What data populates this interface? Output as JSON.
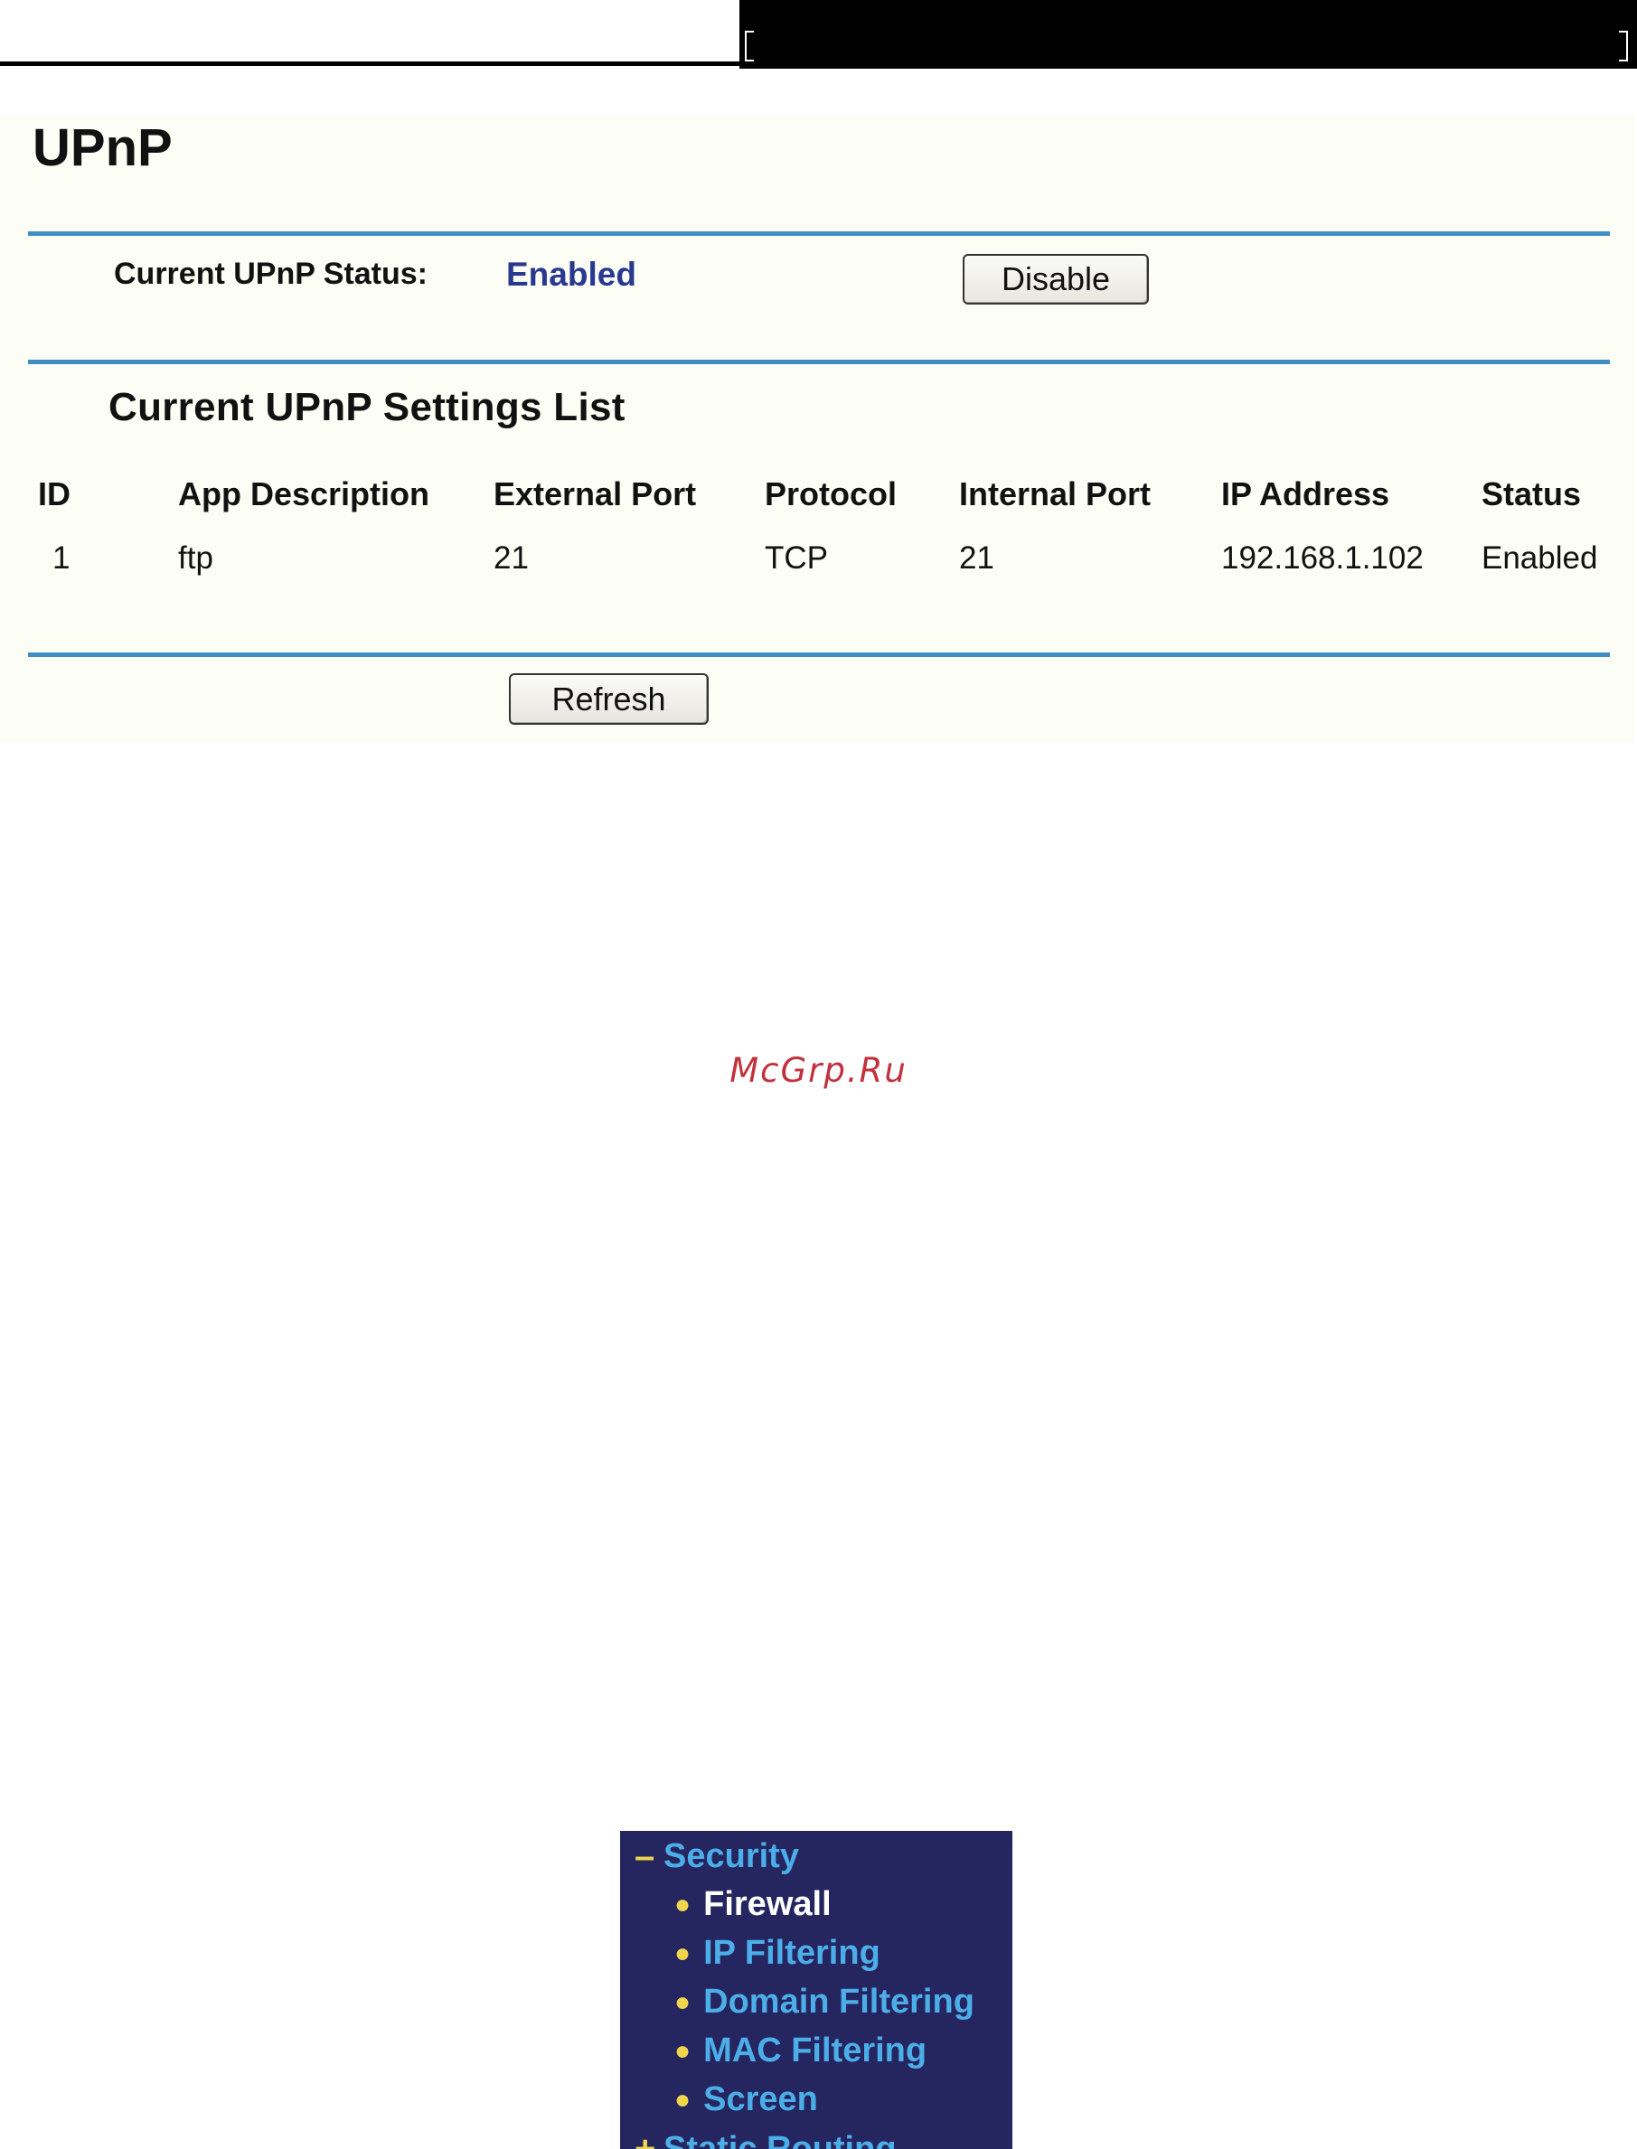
{
  "upnp": {
    "title": "UPnP",
    "status_label": "Current UPnP Status:",
    "status_value": "Enabled",
    "disable_button": "Disable",
    "list_title": "Current UPnP Settings List",
    "table": {
      "headers": [
        "ID",
        "App Description",
        "External Port",
        "Protocol",
        "Internal Port",
        "IP Address",
        "Status"
      ],
      "rows": [
        [
          "1",
          "ftp",
          "21",
          "TCP",
          "21",
          "192.168.1.102",
          "Enabled"
        ]
      ]
    },
    "refresh_button": "Refresh"
  },
  "watermark": "McGrp.Ru",
  "menu": {
    "section_label": "Security",
    "items": [
      "Firewall",
      "IP Filtering",
      "Domain Filtering",
      "MAC Filtering",
      "Screen"
    ],
    "active_item": "Firewall",
    "next_section_partial": "Static Routing"
  },
  "colors": {
    "panel_bg": "#fcfdf4",
    "rule_blue": "#3f8fc6",
    "status_blue": "#2a3990",
    "menu_bg": "#252560",
    "menu_link": "#4caee8",
    "menu_accent": "#f0d64d",
    "watermark_red": "#c3303e"
  },
  "icons": {
    "section_toggle": "minus-icon",
    "menu_bullet": "bullet-icon"
  }
}
